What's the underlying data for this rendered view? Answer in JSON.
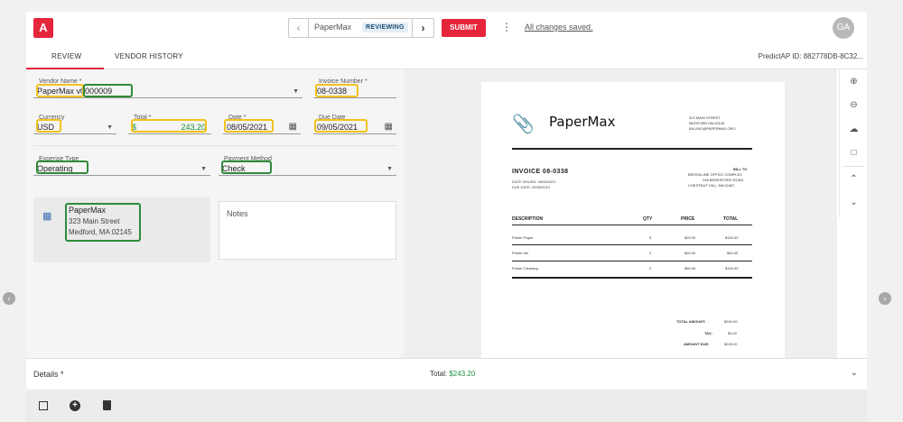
{
  "app": {
    "logo_text": "A",
    "brand_color": "#e4253c"
  },
  "header": {
    "doc_name": "PaperMax",
    "status_badge": "REVIEWING",
    "prev_icon": "chevron-left-icon",
    "next_icon": "chevron-right-icon",
    "submit_label": "SUBMIT",
    "saved_text": "All changes saved.",
    "avatar_initials": "GA"
  },
  "tabs": {
    "review": "REVIEW",
    "vendor_history": "VENDOR HISTORY",
    "predict_id": "PredictAP ID: 882778DB-8C32..."
  },
  "form": {
    "vendor_name_label": "Vendor Name *",
    "vendor_name": "PaperMax",
    "vendor_code": "v0000009",
    "invoice_number_label": "Invoice Number *",
    "invoice_number": "08-0338",
    "currency_label": "Currency",
    "currency": "USD",
    "total_label": "Total *",
    "total_symbol": "$",
    "total_value": "243.20",
    "date_label": "Date *",
    "date": "08/05/2021",
    "due_date_label": "Due Date",
    "due_date": "09/05/2021",
    "expense_type_label": "Expense Type",
    "expense_type": "Operating",
    "payment_method_label": "Payment Method",
    "payment_method": "Check",
    "vendor_card_name": "PaperMax",
    "vendor_card_address1": "323 Main Street",
    "vendor_card_address2": "Medford, MA 02145",
    "notes_placeholder": "Notes"
  },
  "invoice_doc": {
    "company": "PaperMax",
    "address_line1": "323 MAIN STREET",
    "address_line2": "MEDFORD MA 02145",
    "email": "BILLING@PAPERMAX.ORG",
    "invoice_title": "INVOICE 08-0338",
    "date_issued": "DATE ISSUED: 08/05/2021",
    "due_date": "DUE DATE: 09/05/2021",
    "bill_to_label": "BILL TO",
    "bill_to_line1": "BROOKLINE OFFICE COMPLEX",
    "bill_to_line2": "138 BERESFORD ROAD",
    "bill_to_line3": "CHESTNUT HILL, MA 02467",
    "columns": [
      "DESCRIPTION",
      "QTY",
      "PRICE",
      "TOTAL"
    ],
    "rows": [
      {
        "desc": "Printer Paper",
        "qty": "5",
        "price": "$20.00",
        "total": "$100.00"
      },
      {
        "desc": "Printer Ink",
        "qty": "2",
        "price": "$20.00",
        "total": "$40.00"
      },
      {
        "desc": "Printer Cleaning",
        "qty": "2",
        "price": "$50.00",
        "total": "$100.00"
      }
    ],
    "total_amount_label": "TOTAL AMOUNT:",
    "total_amount": "$240.00",
    "tax_label": "TAX:",
    "tax": "$3.20",
    "amount_due_label": "AMOUNT DUE:",
    "amount_due": "$243.20"
  },
  "tools": [
    "zoom-in-icon",
    "zoom-out-icon",
    "cloud-download-icon",
    "window-icon",
    "chevron-up-icon",
    "chevron-down-icon"
  ],
  "details": {
    "title": "Details *",
    "total_label": "Total:",
    "total_value": "$243.20"
  }
}
